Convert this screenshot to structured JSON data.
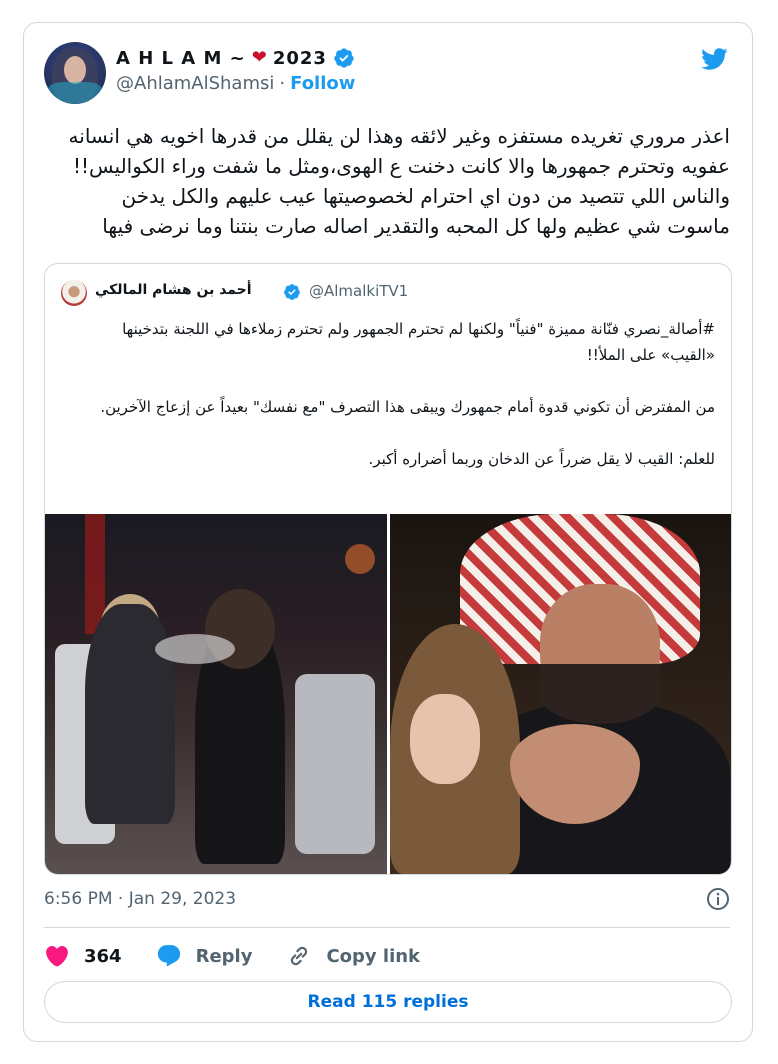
{
  "author": {
    "name": "A H L A M ~",
    "name_suffix": "2023",
    "heart": "❤",
    "handle": "@AhlamAlShamsi",
    "separator": "·",
    "follow_label": "Follow"
  },
  "tweet": {
    "lines": [
      "اعذر مروري تغريده مستفزه وغير لائقه وهذا لن يقلل من قدرها اخويه هي انسانه",
      "عفويه وتحترم جمهورها والا كانت دخنت ع الهوى،ومثل ما شفت وراء الكواليس!!",
      "والناس اللي تتصيد من دون اي احترام لخصوصيتها عيب عليهم والكل يدخن",
      "ماسوت شي عظيم ولها كل المحبه والتقدير اصاله صارت بنتنا وما نرضى فيها"
    ]
  },
  "quote": {
    "name": "أحمد بن هشام المالكي",
    "handle": "@AlmalkiTV1",
    "paragraphs": [
      "#أصالة_نصري فنّانة مميزة \"فنياً\" ولكنها لم تحترم الجمهور ولم تحترم زملاءها في اللجنة بتدخينها",
      "«القيب» على الملأ!!",
      "",
      "من المفترض أن تكوني قدوة أمام جمهورك ويبقى هذا التصرف \"مع نفسك\" بعيداً عن إزعاج الآخرين.",
      "",
      "للعلم: القيب لا يقل ضرراً عن الدخان وربما أضراره أكبر."
    ]
  },
  "meta": {
    "timestamp": "6:56 PM · Jan 29, 2023"
  },
  "actions": {
    "likes_count": "364",
    "reply_label": "Reply",
    "copy_link_label": "Copy link"
  },
  "read_replies_label": "Read 115 replies",
  "icons": {
    "verified": "verified-badge-icon",
    "bird": "twitter-bird-icon",
    "info": "info-icon",
    "heart": "heart-icon",
    "reply": "speech-bubble-icon",
    "link": "link-icon"
  },
  "colors": {
    "accent": "#1d9bf0",
    "like": "#f91880",
    "text": "#0f1419",
    "muted": "#536471",
    "border": "#cfd9de"
  }
}
